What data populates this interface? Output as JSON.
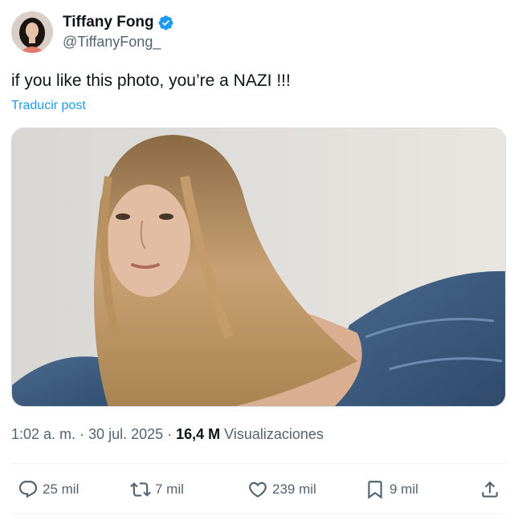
{
  "author": {
    "display_name": "Tiffany Fong",
    "handle": "@TiffanyFong_",
    "verified": true
  },
  "tweet": {
    "text": "if you like this photo, you’re a NAZI !!!",
    "translate_label": "Traducir post"
  },
  "meta": {
    "time": "1:02 a. m.",
    "sep1": " · ",
    "date": "30 jul. 2025",
    "sep2": " · ",
    "views_count": "16,4 M",
    "views_label": "Visualizaciones"
  },
  "actions": {
    "replies": "25 mil",
    "reposts": "7 mil",
    "likes": "239 mil",
    "bookmarks": "9 mil"
  },
  "colors": {
    "accent": "#1d9bf0",
    "secondary_text": "#536471",
    "primary_text": "#0f1419"
  }
}
